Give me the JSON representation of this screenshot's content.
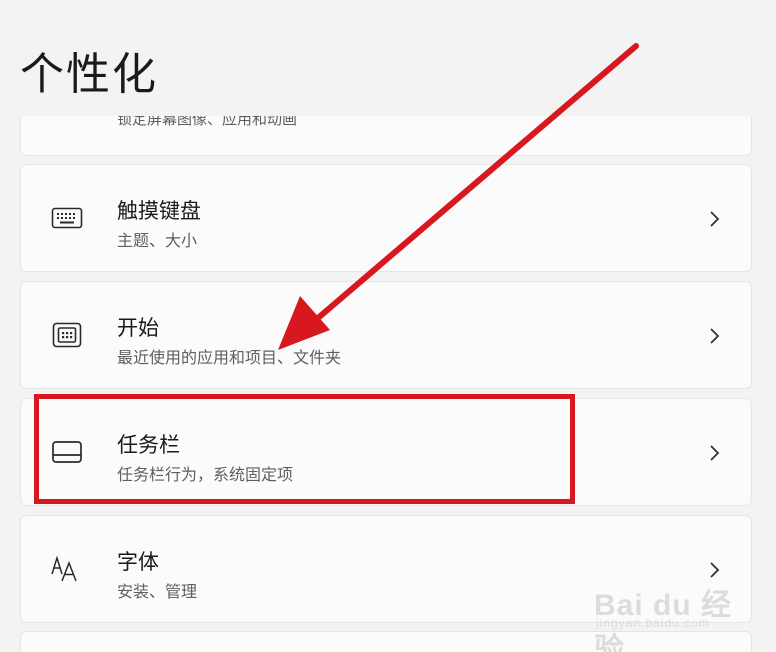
{
  "header": {
    "title": "个性化"
  },
  "partial_item": {
    "subtitle_cut": "锁定屏幕图像、应用和动画"
  },
  "items": [
    {
      "title": "触摸键盘",
      "subtitle": "主题、大小",
      "icon": "keyboard-icon"
    },
    {
      "title": "开始",
      "subtitle": "最近使用的应用和项目、文件夹",
      "icon": "start-menu-icon"
    },
    {
      "title": "任务栏",
      "subtitle": "任务栏行为，系统固定项",
      "icon": "taskbar-icon"
    },
    {
      "title": "字体",
      "subtitle": "安装、管理",
      "icon": "fonts-icon"
    }
  ],
  "annotation": {
    "color": "#d7191f",
    "highlighted_item": "任务栏"
  },
  "watermark": {
    "brand": "Bai du 经验",
    "url": "jingyan.baidu.com"
  }
}
